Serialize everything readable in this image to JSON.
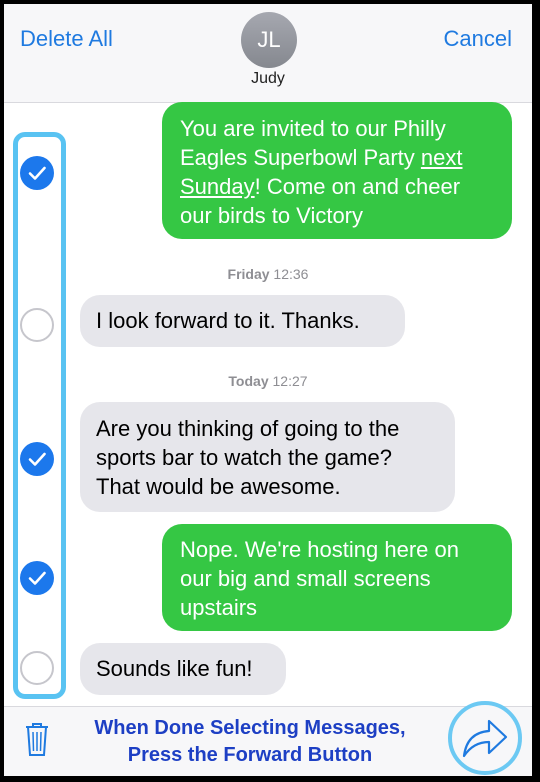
{
  "header": {
    "delete_all": "Delete All",
    "cancel": "Cancel",
    "avatar_initials": "JL",
    "contact_name": "Judy"
  },
  "messages": [
    {
      "direction": "outgoing",
      "selected": true,
      "lines": [
        [
          "You are invited to our Philly"
        ],
        [
          "Eagles Superbowl Party ",
          {
            "u": "next"
          }
        ],
        [
          {
            "u": "Sunday"
          },
          "! Come on and cheer"
        ],
        [
          "our birds to Victory"
        ]
      ]
    },
    {
      "direction": "incoming",
      "selected": false,
      "lines": [
        [
          "I look forward to it. Thanks."
        ]
      ]
    },
    {
      "direction": "incoming",
      "selected": true,
      "lines": [
        [
          "Are you thinking of going to the"
        ],
        [
          "sports bar to watch the game?"
        ],
        [
          "That would be awesome."
        ]
      ]
    },
    {
      "direction": "outgoing",
      "selected": true,
      "lines": [
        [
          "Nope. We're hosting here on"
        ],
        [
          "our big and small screens"
        ],
        [
          "upstairs"
        ]
      ]
    },
    {
      "direction": "incoming",
      "selected": false,
      "lines": [
        [
          "Sounds like fun!"
        ]
      ]
    }
  ],
  "timestamps": [
    {
      "day": "Friday",
      "time": "12:36"
    },
    {
      "day": "Today",
      "time": "12:27"
    }
  ],
  "toolbar": {
    "instruction_line1": "When Done Selecting Messages,",
    "instruction_line2": "Press the Forward Button"
  },
  "colors": {
    "accent": "#1f7ae0",
    "outgoing_bubble": "#35c744",
    "incoming_bubble": "#e6e6eb",
    "selection_highlight": "#59c3f2",
    "instruction_text": "#1d3fc4"
  },
  "icons": {
    "checkbox_checked": "checkmark-circle",
    "trash": "trash-icon",
    "forward": "forward-arrow-icon"
  }
}
